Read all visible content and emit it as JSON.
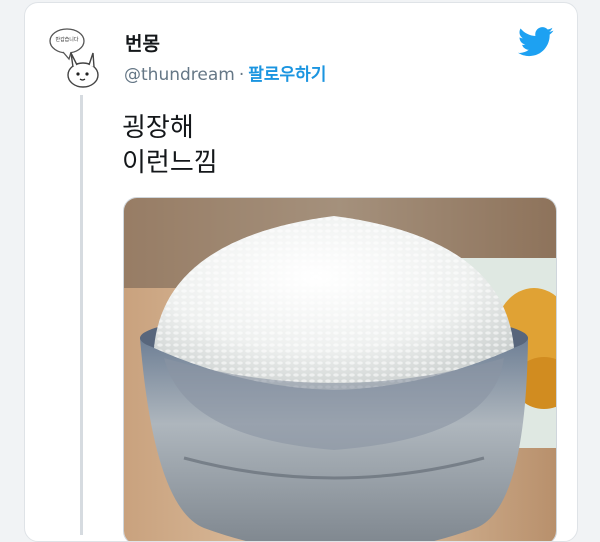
{
  "tweet": {
    "display_name": "번몽",
    "handle": "@thundream",
    "separator": "·",
    "follow_label": "팔로우하기",
    "text_lines": [
      "굉장해",
      "이런느낌"
    ],
    "avatar_bubble_text": "반갑습니다",
    "media_description_icon": "rice-bowl-photo"
  },
  "colors": {
    "accent": "#1b95e0",
    "twitter_blue": "#1da1f2",
    "text": "#14171a",
    "muted": "#657786"
  },
  "icons": {
    "brand": "twitter-bird-icon"
  }
}
